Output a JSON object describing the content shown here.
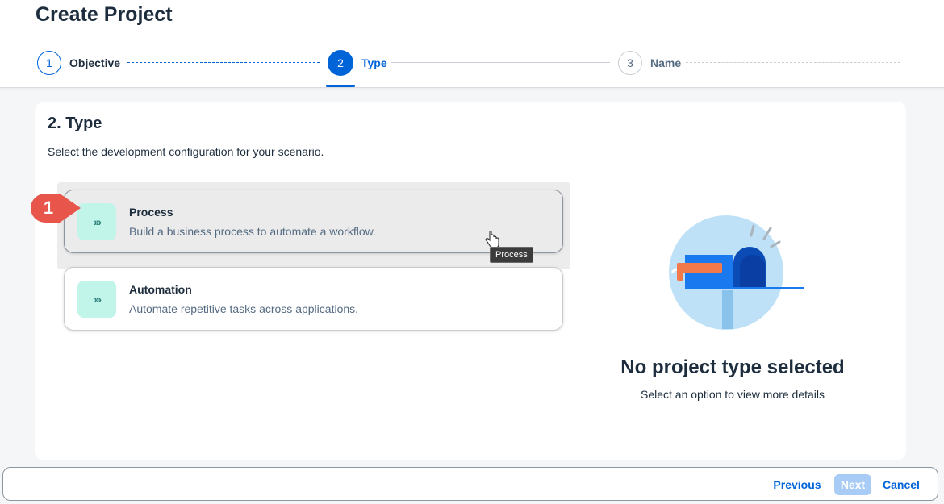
{
  "page": {
    "title": "Create Project"
  },
  "wizard": {
    "steps": [
      {
        "number": "1",
        "label": "Objective",
        "state": "completed"
      },
      {
        "number": "2",
        "label": "Type",
        "state": "active"
      },
      {
        "number": "3",
        "label": "Name",
        "state": "upcoming"
      }
    ]
  },
  "section": {
    "title": "2. Type",
    "description": "Select the development configuration for your scenario."
  },
  "options": [
    {
      "title": "Process",
      "description": "Build a business process to automate a workflow.",
      "icon": "chevrons-right-icon",
      "state": "hover"
    },
    {
      "title": "Automation",
      "description": "Automate repetitive tasks across applications.",
      "icon": "chevrons-right-icon",
      "state": "default"
    }
  ],
  "icon_glyph": "›››",
  "empty_state": {
    "title": "No project type selected",
    "subtitle": "Select an option to view more details",
    "illustration": "mailbox-illustration"
  },
  "tooltip": {
    "text": "Process"
  },
  "annotation": {
    "number": "1",
    "color": "#e8554a"
  },
  "footer": {
    "previous_label": "Previous",
    "next_label": "Next",
    "next_enabled": false,
    "cancel_label": "Cancel"
  },
  "colors": {
    "accent": "#0064d9",
    "icon_tile": "#c2f5ea",
    "disabled_button": "#a8ccf5"
  }
}
